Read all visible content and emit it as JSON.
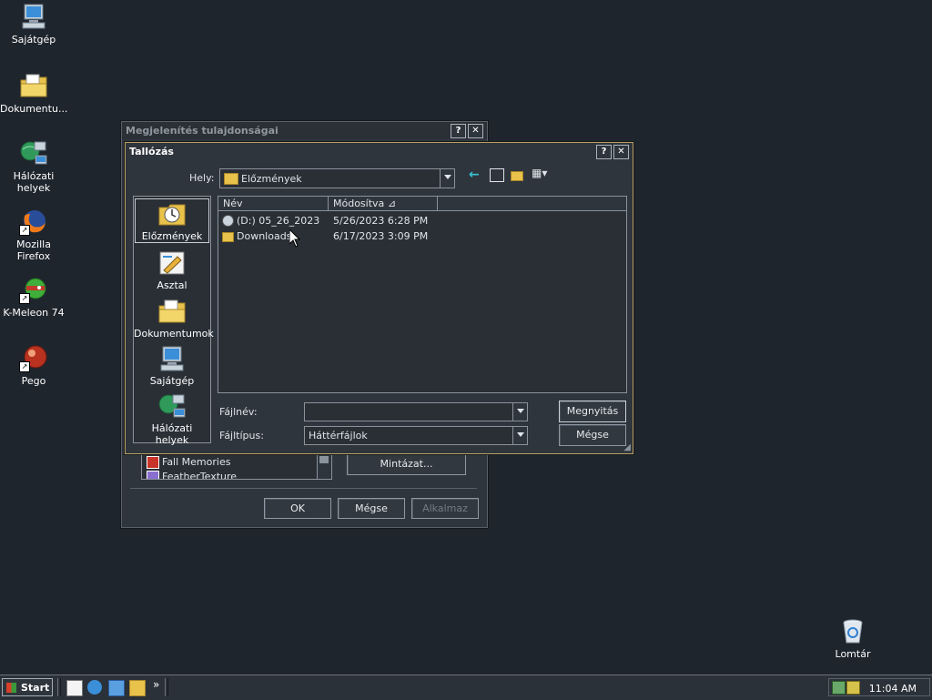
{
  "desktop": {
    "icons": [
      {
        "label": "Sajátgép",
        "icon": "computer-icon"
      },
      {
        "label": "Dokumentu...",
        "icon": "documents-folder-icon"
      },
      {
        "label": "Hálózati helyek",
        "icon": "network-places-icon"
      },
      {
        "label": "Mozilla Firefox",
        "icon": "firefox-icon"
      },
      {
        "label": "K-Meleon 74",
        "icon": "kmeleon-icon"
      },
      {
        "label": "Pego",
        "icon": "pego-icon"
      },
      {
        "label": "Lomtár",
        "icon": "recycle-bin-icon"
      }
    ]
  },
  "bg_window": {
    "title": "Megjelenítés tulajdonságai",
    "help": "?",
    "close": "✕",
    "list_items": [
      "Fall Memories",
      "FeatherTexture"
    ],
    "pattern_button": "Mintázat...",
    "ok_button": "OK",
    "cancel_button": "Mégse",
    "apply_button": "Alkalmaz"
  },
  "dialog": {
    "title": "Tallózás",
    "help": "?",
    "close": "✕",
    "location_label": "Hely:",
    "location_value": "Előzmények",
    "places": [
      {
        "label": "Előzmények",
        "icon": "history-icon",
        "selected": true
      },
      {
        "label": "Asztal",
        "icon": "desktop-icon",
        "selected": false
      },
      {
        "label": "Dokumentumok",
        "icon": "my-documents-icon",
        "selected": false
      },
      {
        "label": "Sajátgép",
        "icon": "my-computer-icon",
        "selected": false
      },
      {
        "label": "Hálózati helyek",
        "icon": "network-icon",
        "selected": false
      }
    ],
    "columns": {
      "name": "Név",
      "modified": "Módosítva"
    },
    "files": [
      {
        "name": "(D:) 05_26_2023",
        "modified": "5/26/2023 6:28 PM",
        "icon": "drive-icon"
      },
      {
        "name": "Downloads",
        "modified": "6/17/2023 3:09 PM",
        "icon": "folder-icon"
      }
    ],
    "filename_label": "Fájlnév:",
    "filename_value": "",
    "filetype_label": "Fájltípus:",
    "filetype_value": "Háttérfájlok",
    "open_button": "Megnyitás",
    "cancel_button": "Mégse"
  },
  "taskbar": {
    "start_label": "Start",
    "more": "»",
    "clock": "11:04 AM"
  },
  "colors": {
    "desktop": "#1f252d",
    "window": "#2f353d",
    "dialog_border": "#b8a060",
    "accent_teal": "#36c6d6"
  }
}
